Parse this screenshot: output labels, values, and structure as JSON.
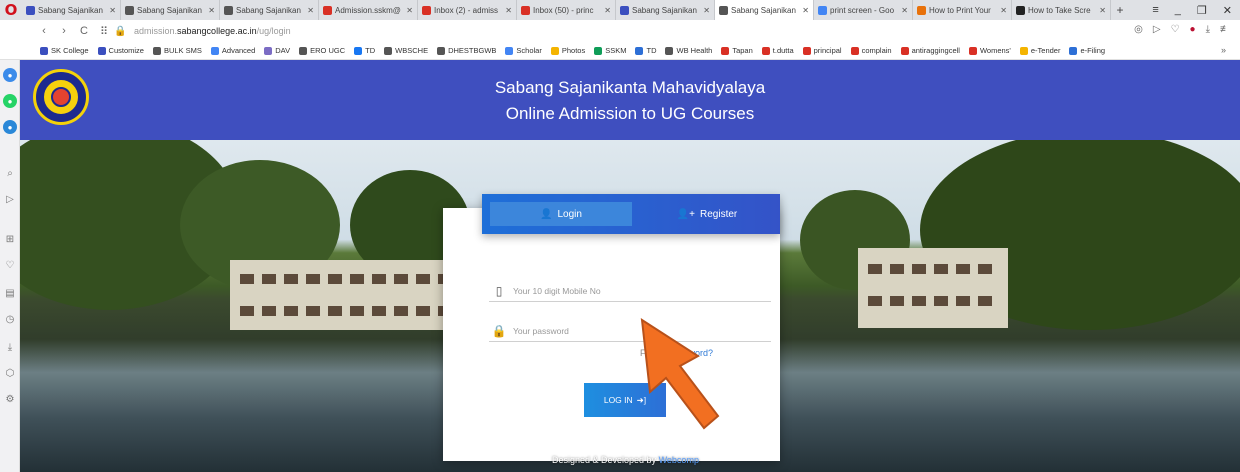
{
  "browser": {
    "tabs": [
      {
        "label": "Sabang Sajanikan",
        "color": "#3b4fbf",
        "active": false
      },
      {
        "label": "Sabang Sajanikan",
        "color": "#555555",
        "active": false
      },
      {
        "label": "Sabang Sajanikan",
        "color": "#555555",
        "active": false
      },
      {
        "label": "Admission.sskm@",
        "color": "#d93025",
        "active": false
      },
      {
        "label": "Inbox (2) - admiss",
        "color": "#d93025",
        "active": false
      },
      {
        "label": "Inbox (50) - princ",
        "color": "#d93025",
        "active": false
      },
      {
        "label": "Sabang Sajanikan",
        "color": "#3b4fbf",
        "active": false
      },
      {
        "label": "Sabang Sajanikan",
        "color": "#555555",
        "active": true
      },
      {
        "label": "print screen - Goo",
        "color": "#4285f4",
        "active": false
      },
      {
        "label": "How to Print Your",
        "color": "#e8710a",
        "active": false
      },
      {
        "label": "How to Take Scre",
        "color": "#222222",
        "active": false
      }
    ],
    "url_prefix": "admission.",
    "url_domain": "sabangcollege.ac.in",
    "url_path": "/ug/login",
    "bookmarks": [
      {
        "label": "SK College",
        "color": "#3b4fbf"
      },
      {
        "label": "Customize",
        "color": "#3b4fbf"
      },
      {
        "label": "BULK SMS",
        "color": "#555555"
      },
      {
        "label": "Advanced",
        "color": "#4285f4"
      },
      {
        "label": "DAV",
        "color": "#7b6cc4"
      },
      {
        "label": "ERO UGC",
        "color": "#555555"
      },
      {
        "label": "TD",
        "color": "#1877f2"
      },
      {
        "label": "WBSCHE",
        "color": "#555555"
      },
      {
        "label": "DHESTBGWB",
        "color": "#555555"
      },
      {
        "label": "Scholar",
        "color": "#4285f4"
      },
      {
        "label": "Photos",
        "color": "#f4b400"
      },
      {
        "label": "SSKM",
        "color": "#0f9d58"
      },
      {
        "label": "TD",
        "color": "#2d6fd6"
      },
      {
        "label": "WB Health",
        "color": "#555555"
      },
      {
        "label": "Tapan",
        "color": "#d93025"
      },
      {
        "label": "t.dutta",
        "color": "#d93025"
      },
      {
        "label": "principal",
        "color": "#d93025"
      },
      {
        "label": "complain",
        "color": "#d93025"
      },
      {
        "label": "antiraggingcell",
        "color": "#d93025"
      },
      {
        "label": "Womens'",
        "color": "#d93025"
      },
      {
        "label": "e-Tender",
        "color": "#f4b400"
      },
      {
        "label": "e-Filing",
        "color": "#2d6fd6"
      }
    ],
    "bookmarks_more": "»"
  },
  "header": {
    "title_line1": "Sabang Sajanikanta Mahavidyalaya",
    "title_line2": "Online Admission to UG Courses"
  },
  "form": {
    "tab_login": "Login",
    "tab_register": "Register",
    "mobile_placeholder": "Your 10 digit Mobile No",
    "password_placeholder": "Your password",
    "forgot_prefix": "Forgot",
    "forgot_link": "Password?",
    "login_button": "LOG IN"
  },
  "footer": {
    "credit_text": "Designed & Developed by",
    "credit_company": "Webcomp"
  },
  "colors": {
    "header_bg": "#3f4fbf",
    "accent": "#2f7ad6",
    "arrow": "#f26f21"
  }
}
